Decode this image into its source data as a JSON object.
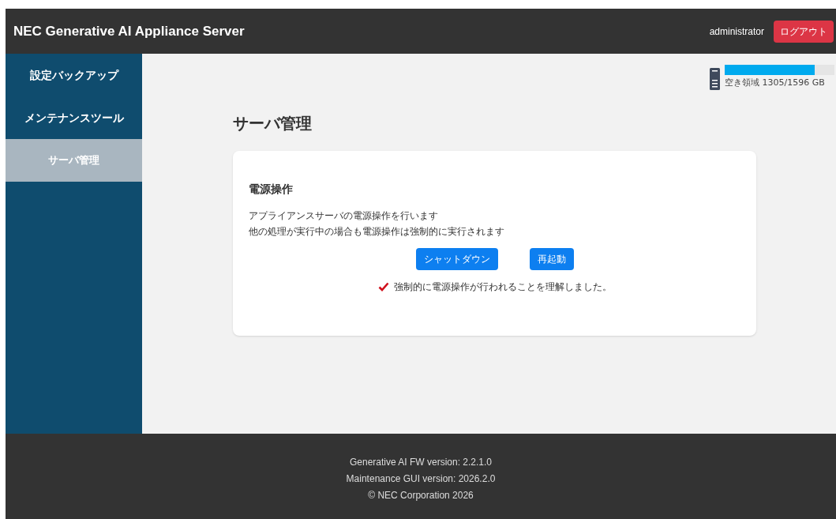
{
  "header": {
    "title": "NEC Generative AI Appliance Server",
    "user": "administrator",
    "logout": "ログアウト"
  },
  "sidebar": {
    "items": [
      {
        "label": "設定バックアップ",
        "selected": false
      },
      {
        "label": "メンテナンスツール",
        "selected": false
      },
      {
        "label": "サーバ管理",
        "selected": true
      }
    ]
  },
  "storage": {
    "level": 0.82,
    "label": "空き領域 1305/1596 GB"
  },
  "page_title": "サーバ管理",
  "card": {
    "title": "電源操作",
    "lines": [
      "アプライアンスサーバの電源操作を行います",
      "他の処理が実行中の場合も電源操作は強制的に実行されます"
    ],
    "buttons": [
      "シャットダウン",
      "再起動"
    ],
    "confirm": {
      "label": "強制的に電源操作が行われることを理解しました。",
      "checked": true
    }
  },
  "footer": [
    "Generative AI FW version: 2.2.1.0",
    "Maintenance GUI version: 2026.2.0",
    "© NEC Corporation 2026"
  ]
}
